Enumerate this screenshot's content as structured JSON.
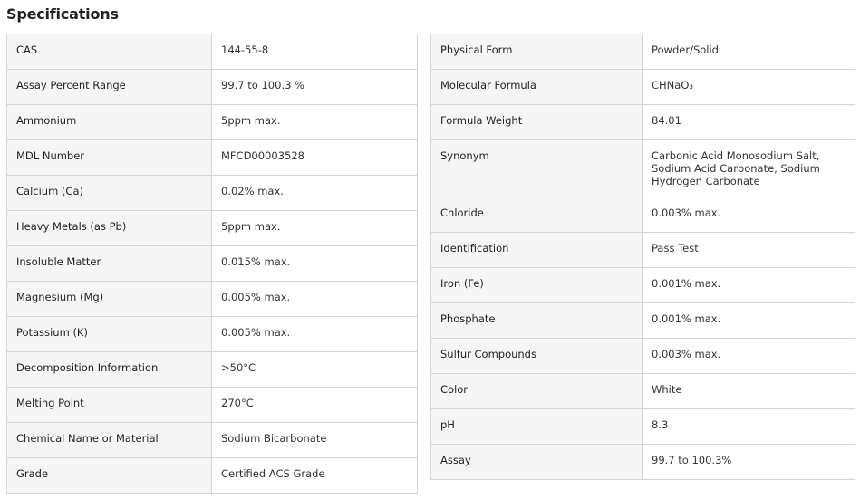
{
  "title": "Specifications",
  "left_table": [
    {
      "label": "CAS",
      "value": "144-55-8"
    },
    {
      "label": "Assay Percent Range",
      "value": "99.7 to 100.3 %"
    },
    {
      "label": "Ammonium",
      "value": "5ppm max."
    },
    {
      "label": "MDL Number",
      "value": "MFCD00003528"
    },
    {
      "label": "Calcium (Ca)",
      "value": "0.02% max."
    },
    {
      "label": "Heavy Metals (as Pb)",
      "value": "5ppm max."
    },
    {
      "label": "Insoluble Matter",
      "value": "0.015% max."
    },
    {
      "label": "Magnesium (Mg)",
      "value": "0.005% max."
    },
    {
      "label": "Potassium (K)",
      "value": "0.005% max."
    },
    {
      "label": "Decomposition Information",
      "value": ">50°C"
    },
    {
      "label": "Melting Point",
      "value": "270°C"
    },
    {
      "label": "Chemical Name or Material",
      "value": "Sodium Bicarbonate"
    },
    {
      "label": "Grade",
      "value": "Certified ACS Grade"
    }
  ],
  "right_table": [
    {
      "label": "Physical Form",
      "value": "Powder/Solid"
    },
    {
      "label": "Molecular Formula",
      "value": "CHNaO₃"
    },
    {
      "label": "Formula Weight",
      "value": "84.01"
    },
    {
      "label": "Synonym",
      "value": "Carbonic Acid Monosodium Salt, Sodium Acid Carbonate, Sodium Hydrogen Carbonate"
    },
    {
      "label": "Chloride",
      "value": "0.003% max."
    },
    {
      "label": "Identification",
      "value": "Pass Test"
    },
    {
      "label": "Iron (Fe)",
      "value": "0.001% max."
    },
    {
      "label": "Phosphate",
      "value": "0.001% max."
    },
    {
      "label": "Sulfur Compounds",
      "value": "0.003% max."
    },
    {
      "label": "Color",
      "value": "White"
    },
    {
      "label": "pH",
      "value": "8.3"
    },
    {
      "label": "Assay",
      "value": "99.7 to 100.3%"
    }
  ]
}
